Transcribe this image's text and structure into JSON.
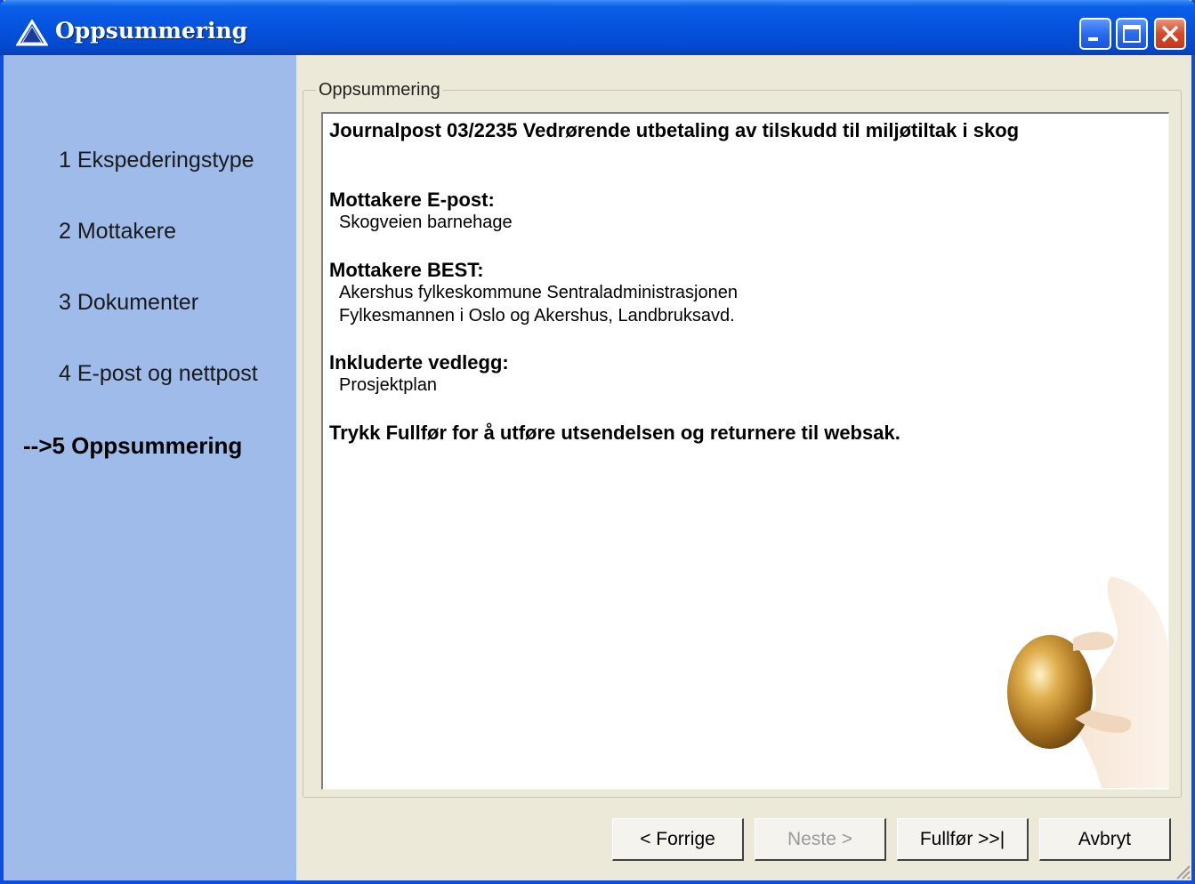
{
  "window": {
    "title": "Oppsummering",
    "app_icon": "triangle-logo-icon",
    "controls": [
      "minimize-icon",
      "maximize-icon",
      "close-icon"
    ]
  },
  "sidebar": {
    "steps": [
      {
        "label": "1 Ekspederingstype",
        "active": false
      },
      {
        "label": "2 Mottakere",
        "active": false
      },
      {
        "label": "3 Dokumenter",
        "active": false
      },
      {
        "label": "4 E-post og nettpost",
        "active": false
      },
      {
        "label": "-->5 Oppsummering",
        "active": true
      }
    ]
  },
  "summary": {
    "group_title": "Oppsummering",
    "heading": "Journalpost 03/2235 Vedrørende utbetaling av tilskudd til miljøtiltak i skog",
    "email_recipients_label": "Mottakere E-post:",
    "email_recipients": [
      "Skogveien barnehage"
    ],
    "best_recipients_label": "Mottakere BEST:",
    "best_recipients": [
      "Akershus fylkeskommune Sentraladministrasjonen",
      "Fylkesmannen i Oslo og Akershus, Landbruksavd."
    ],
    "attachments_label": "Inkluderte vedlegg:",
    "attachments": [
      "Prosjektplan"
    ],
    "instruction": "Trykk Fullfør for å utføre utsendelsen og returnere til websak."
  },
  "buttons": {
    "prev": "< Forrige",
    "next": "Neste >",
    "finish": "Fullfør >>|",
    "cancel": "Avbryt"
  },
  "colors": {
    "titlebar": "#0553dd",
    "sidebar": "#9ebbea",
    "dialog_bg": "#ece9d8"
  }
}
